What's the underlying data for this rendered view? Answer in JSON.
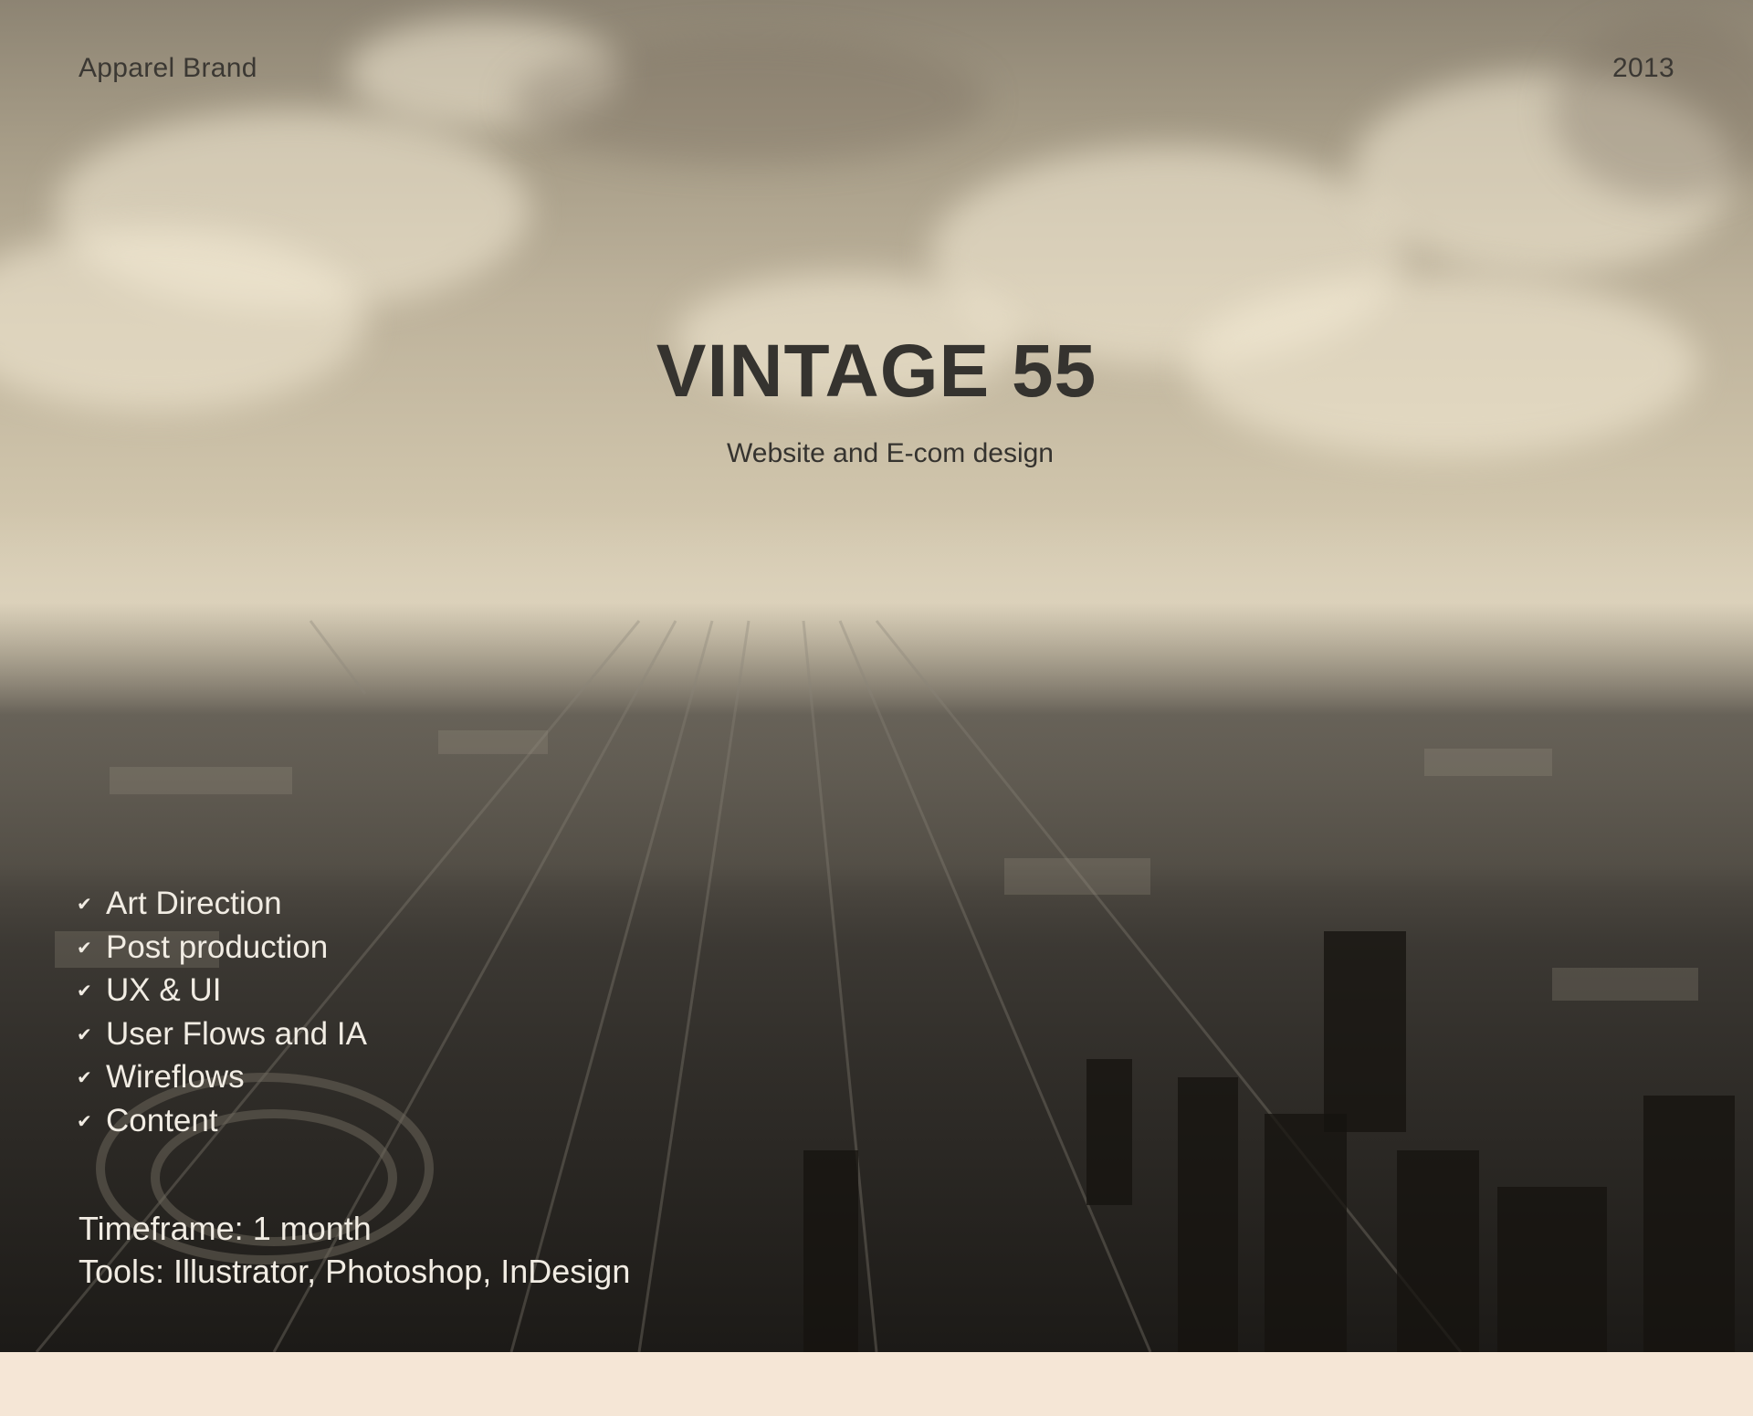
{
  "header": {
    "category": "Apparel Brand",
    "year": "2013"
  },
  "project": {
    "title": "VINTAGE 55",
    "subtitle": "Website and E-com design"
  },
  "services": {
    "check_icon": "check-icon",
    "items": [
      {
        "label": "Art Direction"
      },
      {
        "label": "Post production"
      },
      {
        "label": "UX & UI"
      },
      {
        "label": "User Flows and IA"
      },
      {
        "label": "Wireflows"
      },
      {
        "label": "Content"
      }
    ]
  },
  "details": {
    "timeframe": "Timeframe: 1 month",
    "tools": "Tools: Illustrator, Photoshop, InDesign"
  },
  "colors": {
    "bottom_band": "#f5e6d6",
    "heading_text": "#35332f",
    "light_text": "#f1ece3"
  }
}
